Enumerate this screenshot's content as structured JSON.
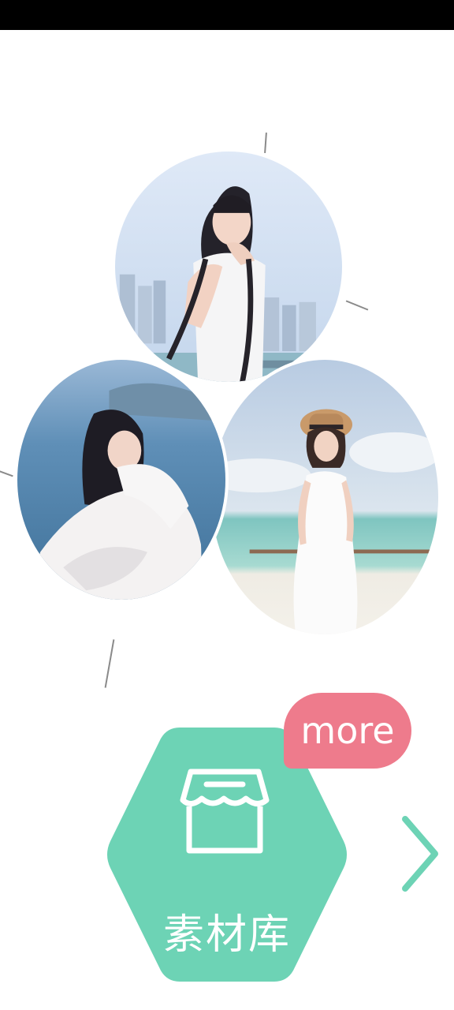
{
  "library": {
    "label": "素材库",
    "more_label": "more",
    "hex_color": "#6dd3b5",
    "more_color": "#ee7b8c"
  },
  "photos": [
    {
      "name": "photo-top",
      "subject": "girl-with-braids-by-sea"
    },
    {
      "name": "photo-left",
      "subject": "girl-in-white-dress-by-water"
    },
    {
      "name": "photo-right",
      "subject": "girl-with-straw-hat-on-beach"
    }
  ],
  "icons": {
    "store": "store-icon",
    "next": "chevron-right-icon"
  }
}
